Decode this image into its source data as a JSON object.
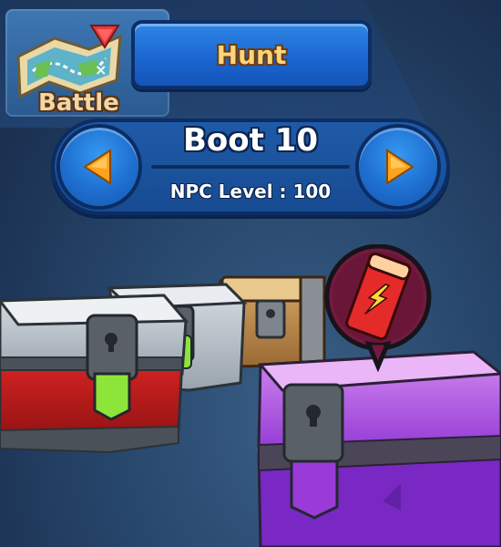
{
  "header": {
    "battle_label": "Battle",
    "hunt_label": "Hunt"
  },
  "stage": {
    "title": "Boot 10",
    "npc_level": "NPC Level : 100"
  },
  "icons": {
    "battle": "map-icon",
    "prev": "arrow-left-icon",
    "next": "arrow-right-icon",
    "ticket": "ticket-icon"
  },
  "colors": {
    "accent": "#1f6fd0",
    "arrow": "#ff9f1a",
    "label_gold": "#ffd37a"
  }
}
